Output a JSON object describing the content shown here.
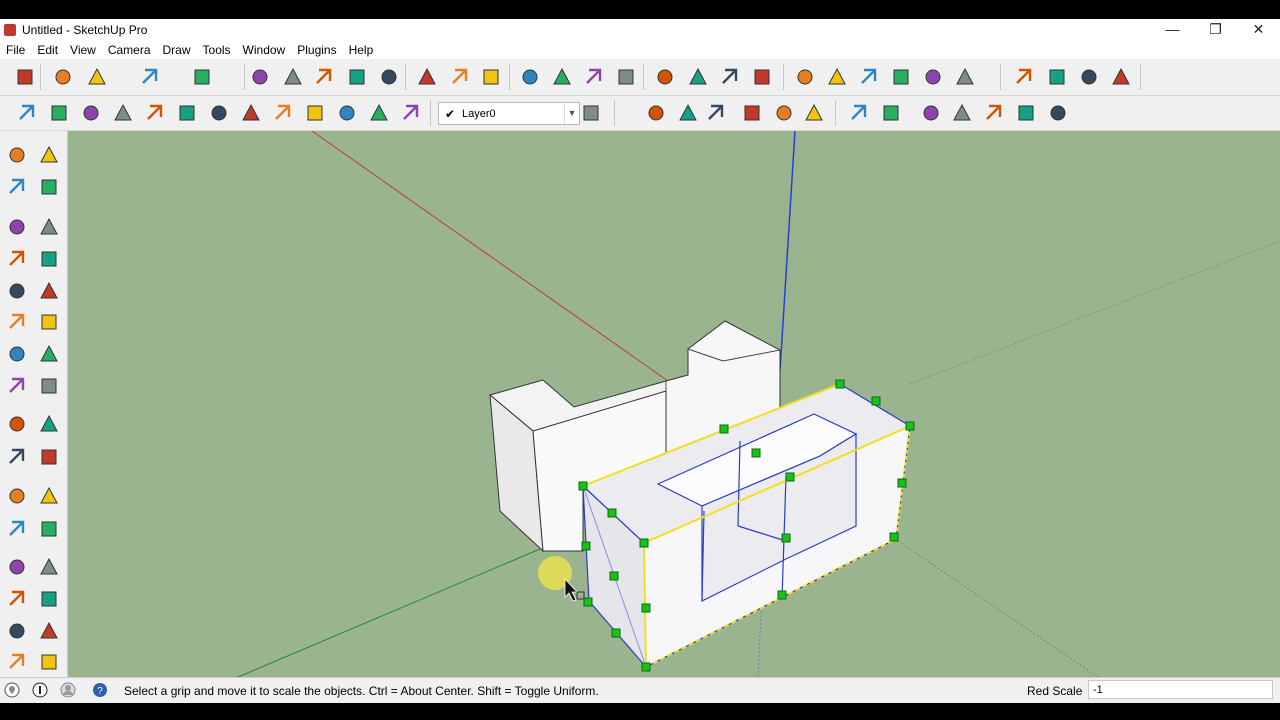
{
  "window": {
    "title": "Untitled - SketchUp Pro",
    "minimize": "—",
    "restore": "❐",
    "close": "✕"
  },
  "menu": [
    "File",
    "Edit",
    "View",
    "Camera",
    "Draw",
    "Tools",
    "Window",
    "Plugins",
    "Help"
  ],
  "layer": {
    "check": "✔",
    "name": "Layer0"
  },
  "status": {
    "message": "Select a grip and move it to scale the objects. Ctrl = About Center. Shift = Toggle Uniform.",
    "vcb_label": "Red Scale",
    "vcb_value": "-1"
  },
  "toolbar_row1_icons": [
    "select-icon",
    "eraser-icon",
    "pencil-line-icon",
    "arc-icon",
    "rectangle-icon",
    "push-pull-icon",
    "follow-me-icon",
    "move-icon",
    "rotate-icon",
    "scale-icon",
    "tape-measure-icon",
    "text-icon",
    "paint-bucket-icon",
    "orbit-icon",
    "pan-icon",
    "zoom-icon",
    "zoom-extents-icon",
    "warehouse-icon",
    "components-icon",
    "materials-icon",
    "styles-icon",
    "iso-view-icon",
    "front-view-icon",
    "top-view-icon",
    "right-view-icon",
    "back-view-icon",
    "left-view-icon",
    "preview-map-icon",
    "photo-texture-icon",
    "geo-location-icon",
    "add-location-icon"
  ],
  "toolbar_row2_icons": [
    "plugin-m-icon",
    "plugin-tag-icon",
    "plugin-r-icon",
    "plugin-rt-icon",
    "plugin-br-icon",
    "help-icon",
    "plugin-label-icon",
    "sphere-icon",
    "plugin-line-icon",
    "plugin-tree-icon",
    "plugin-grass-icon",
    "target-icon",
    "pause-icon",
    "layer-manager-icon",
    "sandbox-icon-1",
    "sandbox-icon-2",
    "sandbox-icon-3",
    "sandbox-icon-4",
    "sandbox-icon-5",
    "sandbox-icon-6",
    "sandbox-icon-7",
    "sandbox-icon-8",
    "sandbox-icon-9",
    "sandbox-icon-10",
    "sandbox-icon-11",
    "sandbox-icon-12",
    "sandbox-icon-13"
  ],
  "left_tools": [
    "select-tool-icon",
    "make-component-icon",
    "paint-bucket-icon",
    "eraser-icon",
    "rectangle-icon",
    "line-icon",
    "circle-icon",
    "freehand-icon",
    "polygon-icon",
    "arc-icon",
    "pie-icon",
    "two-point-arc-icon",
    "move-icon",
    "push-pull-icon",
    "rotate-icon",
    "follow-me-icon",
    "scale-icon",
    "offset-icon",
    "tape-measure-icon",
    "dimension-icon",
    "protractor-icon",
    "text-icon",
    "axes-icon",
    "3d-text-icon",
    "orbit-icon",
    "pan-icon",
    "zoom-icon",
    "zoom-window-icon",
    "zoom-extents-icon",
    "previous-view-icon",
    "walk-icon",
    "look-around-icon"
  ]
}
